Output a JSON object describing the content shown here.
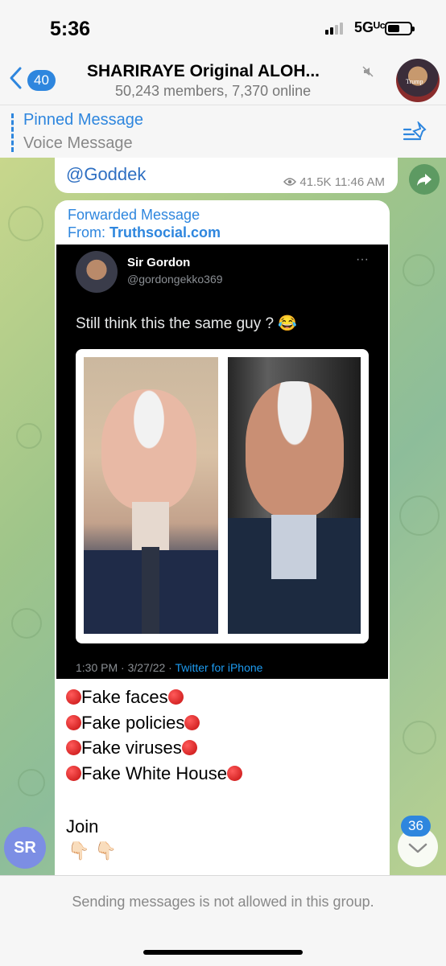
{
  "status": {
    "time": "5:36",
    "network": "5Gᵁᶜ"
  },
  "header": {
    "back_count": "40",
    "title": "SHARIRAYE Original ALOH...",
    "subtitle": "50,243 members, 7,370 online",
    "avatar_text": "Trump"
  },
  "pinned": {
    "title": "Pinned Message",
    "subtitle": "Voice Message"
  },
  "messages": [
    {
      "handle": "@Goddek",
      "views": "41.5K",
      "time": "11:46 AM"
    },
    {
      "forwarded_label": "Forwarded Message",
      "from_label": "From:",
      "from_source": "Truthsocial.com",
      "tweet": {
        "name": "Sir Gordon",
        "handle": "@gordongekko369",
        "dots": "···",
        "text": "Still think this the same guy ? 😂",
        "meta": "1:30 PM · 3/27/22 · ",
        "client": "Twitter for iPhone"
      },
      "lines": [
        "Fake faces",
        "Fake policies",
        "Fake viruses",
        "Fake White House"
      ],
      "join": "Join",
      "hands": "👇🏻 👇🏻"
    }
  ],
  "sender_initials": "SR",
  "unread_count": "36",
  "footer_note": "Sending messages is not allowed in this group.",
  "colors": {
    "accent": "#2e86de",
    "twitter_blue": "#1d9bf0",
    "alert_red": "#d81b1b"
  },
  "icons": [
    "back-chevron-icon",
    "mute-icon",
    "pin-list-icon",
    "eye-icon",
    "share-arrow-icon",
    "chevron-down-icon"
  ]
}
